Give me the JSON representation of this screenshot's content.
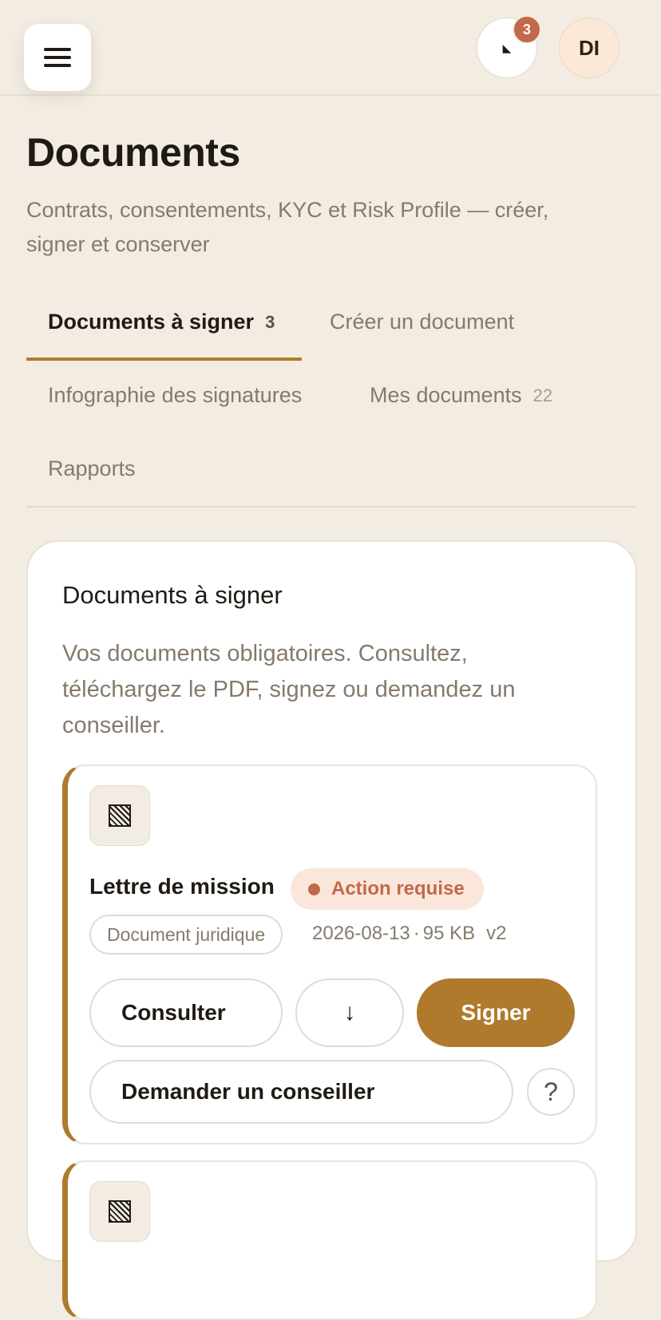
{
  "header": {
    "notifications_count": "3",
    "avatar_initials": "DI"
  },
  "page": {
    "title": "Documents",
    "subtitle": "Contrats, consentements, KYC et Risk Profile — créer, signer et conserver"
  },
  "tabs": [
    {
      "label": "Documents à signer",
      "count": "3",
      "active": true
    },
    {
      "label": "Créer un document",
      "count": ""
    },
    {
      "label": "Infographie des signatures",
      "count": ""
    },
    {
      "label": "Mes documents",
      "count": "22"
    },
    {
      "label": "Rapports",
      "count": ""
    }
  ],
  "panel": {
    "title": "Documents à signer",
    "description": "Vos documents obligatoires. Consultez, téléchargez le PDF, signez ou demandez un conseiller."
  },
  "documents": [
    {
      "name": "Lettre de mission",
      "status": "Action requise",
      "category": "Document juridique",
      "date": "2026-08-13",
      "size": "95 KB",
      "version": "v2",
      "actions": {
        "consult": "Consulter",
        "download_icon": "↓",
        "sign": "Signer",
        "advisor": "Demander un conseiller",
        "help_icon": "?"
      }
    }
  ],
  "colors": {
    "background": "#f2ece3",
    "accent": "#b07a2c",
    "status": "#c1694a",
    "muted_text": "#857a6c"
  }
}
